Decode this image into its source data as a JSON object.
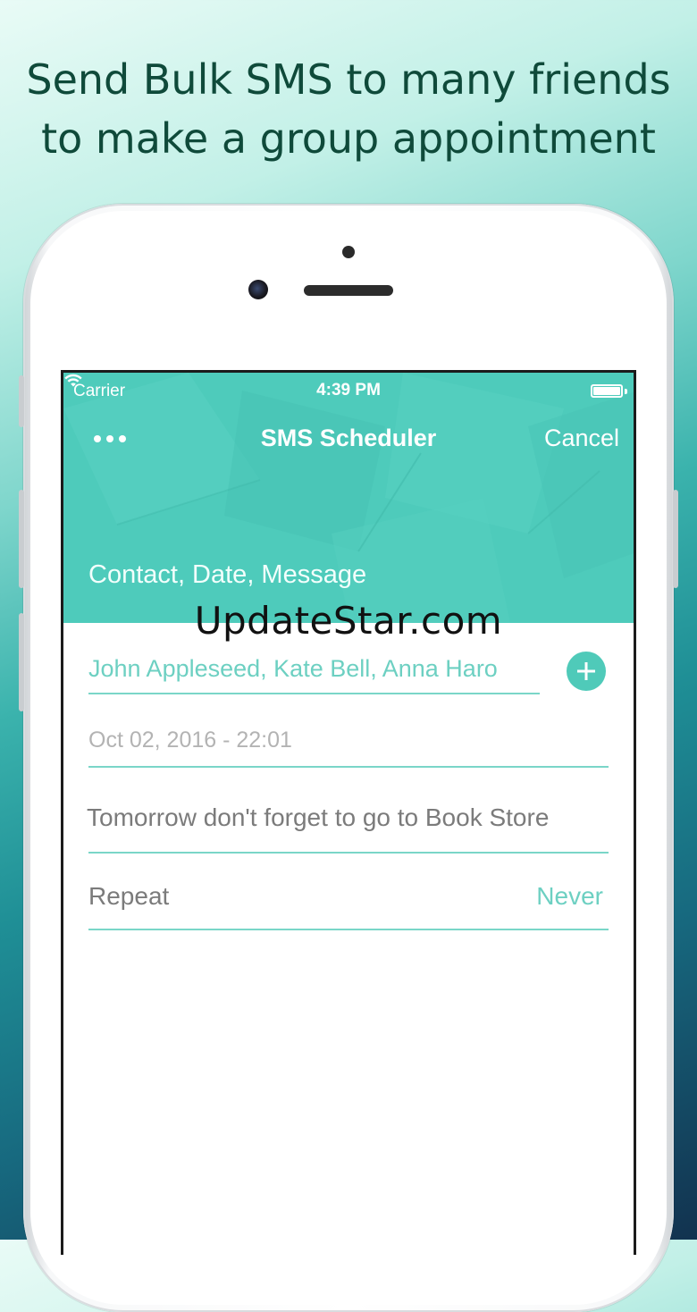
{
  "promo": {
    "headline_line1": "Send Bulk SMS to many friends",
    "headline_line2": "to make a group appointment"
  },
  "status_bar": {
    "carrier": "Carrier",
    "time": "4:39 PM",
    "battery_level": 1.0
  },
  "nav": {
    "title": "SMS Scheduler",
    "cancel_label": "Cancel"
  },
  "form": {
    "section_label": "Contact, Date, Message",
    "contacts_value": "John Appleseed, Kate Bell, Anna Haro",
    "date_value": "Oct 02, 2016 - 22:01",
    "message_value": "Tomorrow don't forget to go to Book Store",
    "repeat_label": "Repeat",
    "repeat_value": "Never"
  },
  "watermark": "UpdateStar.com",
  "colors": {
    "accent": "#4ecbbb",
    "headline": "#0f4a3a"
  }
}
